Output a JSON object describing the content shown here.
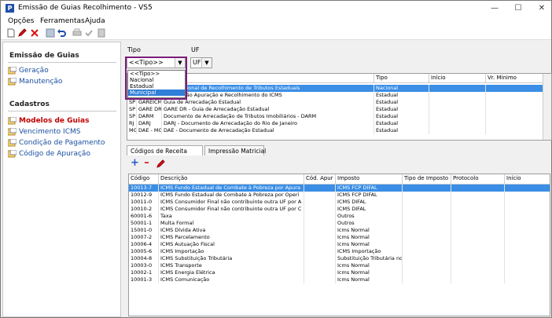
{
  "window": {
    "title": "Emissão de Guias Recolhimento - VS5",
    "app_icon_letter": "P"
  },
  "menu": [
    {
      "label": "Opções",
      "accel": "O"
    },
    {
      "label": "Ferramentas",
      "accel": "F"
    },
    {
      "label": "Ajuda",
      "accel": "A"
    }
  ],
  "sidebar": {
    "section1": "Emissão de Guias",
    "items1": [
      {
        "label": "Geração"
      },
      {
        "label": "Manutenção"
      }
    ],
    "section2": "Cadastros",
    "items2": [
      {
        "label": "Modelos de Guias"
      },
      {
        "label": "Vencimento ICMS"
      },
      {
        "label": "Condição de Pagamento"
      },
      {
        "label": "Código de Apuração"
      }
    ]
  },
  "filters": {
    "tipo_label": "Tipo",
    "tipo_value": "<<Tipo>>",
    "uf_label": "UF",
    "uf_value": "UF",
    "tipo_options": [
      "<<Tipo>>",
      "Nacional",
      "Estadual",
      "Municipal"
    ]
  },
  "models_table": {
    "headers": [
      "",
      "",
      "ão",
      "Tipo",
      "Início",
      "Vr. Mínimo"
    ],
    "rows": [
      [
        "",
        "",
        "Guia Nacional de Recolhimento de Tributos Estaduais",
        "Nacional",
        "",
        ""
      ],
      [
        "",
        "",
        "Informação Apuração e Recolhimento do ICMS",
        "Estadual",
        "",
        ""
      ],
      [
        "SP",
        "GAREICMS",
        "Guia de Arrecadação Estadual",
        "Estadual",
        "",
        ""
      ],
      [
        "SP",
        "GARE DR",
        "GARE DR - Guia de Arrecadação Estadual",
        "Estadual",
        "",
        ""
      ],
      [
        "SP",
        "DARM",
        "Documento de Arrecadação de Tributos Imobiliários - DARM",
        "Estadual",
        "",
        ""
      ],
      [
        "RJ",
        "DARJ",
        "DARJ - Documento de Arrecadação do Rio de Janeiro",
        "Estadual",
        "",
        ""
      ],
      [
        "MG",
        "DAE - MG",
        "DAE - Documento de Arrecadação Estadual",
        "Estadual",
        "",
        ""
      ]
    ]
  },
  "tabs": [
    "Códigos de Receita",
    "Impressão Matricial"
  ],
  "codes_table": {
    "headers": [
      "Código",
      "Descrição",
      "Cód. Apur",
      "Imposto",
      "Tipo de Imposto",
      "Protocolo",
      "Início"
    ],
    "rows": [
      [
        "10013-7",
        "ICMS Fundo Estadual de Combate à Pobreza por Apura",
        "",
        "ICMS FCP DIFAL",
        "",
        "",
        ""
      ],
      [
        "10012-9",
        "ICMS Fundo Estadual de Combate à Pobreza por Operi",
        "",
        "ICMS FCP DIFAL",
        "",
        "",
        ""
      ],
      [
        "10011-0",
        "ICMS Consumidor Final não contribuinte outra UF por A",
        "",
        "ICMS DIFAL",
        "",
        "",
        ""
      ],
      [
        "10010-2",
        "ICMS Consumidor Final não contribuinte outra UF por C",
        "",
        "ICMS DIFAL",
        "",
        "",
        ""
      ],
      [
        "60001-6",
        "Taxa",
        "",
        "Outros",
        "",
        "",
        ""
      ],
      [
        "50001-1",
        "Multa Formal",
        "",
        "Outros",
        "",
        "",
        ""
      ],
      [
        "15001-0",
        "ICMS Dívida Ativa",
        "",
        "Icms Normal",
        "",
        "",
        ""
      ],
      [
        "10007-2",
        "ICMS Parcelamento",
        "",
        "Icms Normal",
        "",
        "",
        ""
      ],
      [
        "10006-4",
        "ICMS Autuação Fiscal",
        "",
        "Icms Normal",
        "",
        "",
        ""
      ],
      [
        "10005-6",
        "ICMS Importação",
        "",
        "ICMS Importação",
        "",
        "",
        ""
      ],
      [
        "10004-8",
        "ICMS Substituição Tributária",
        "",
        "Substituição Tributária no",
        "",
        "",
        ""
      ],
      [
        "10003-0",
        "ICMS Transporte",
        "",
        "Icms Normal",
        "",
        "",
        ""
      ],
      [
        "10002-1",
        "ICMS Energia Elétrica",
        "",
        "Icms Normal",
        "",
        "",
        ""
      ],
      [
        "10001-3",
        "ICMS Comunicação",
        "",
        "Icms Normal",
        "",
        "",
        ""
      ]
    ]
  },
  "colors": {
    "selection": "#3a8ee6",
    "sidebar_link": "#1a4fa0",
    "active_link": "#c00000",
    "add": "#1e5bc6",
    "remove": "#d11a1a"
  }
}
